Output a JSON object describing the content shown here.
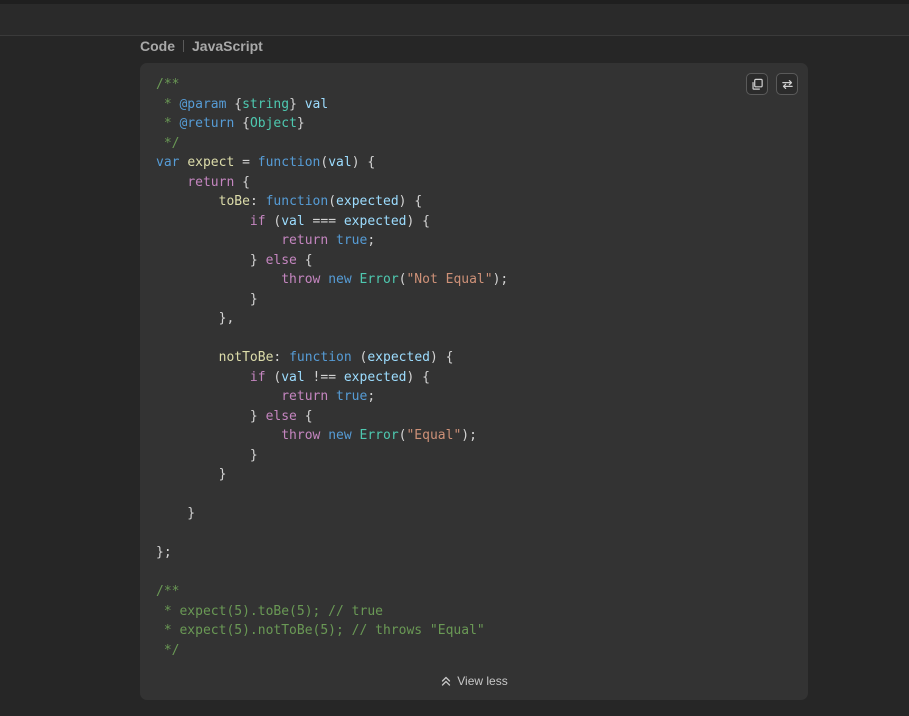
{
  "breadcrumb": {
    "section": "Code",
    "language": "JavaScript"
  },
  "toolbar": {
    "copy_icon": "copy-icon",
    "toggle_icon": "swap-arrows-icon"
  },
  "footer": {
    "toggle_label": "View less",
    "toggle_icon": "double-chevron-up-icon"
  },
  "code_lines": [
    [
      {
        "t": "/**",
        "c": "comment"
      }
    ],
    [
      {
        "t": " * ",
        "c": "comment"
      },
      {
        "t": "@param",
        "c": "tag"
      },
      {
        "t": " {",
        "c": "plain"
      },
      {
        "t": "string",
        "c": "type"
      },
      {
        "t": "} ",
        "c": "plain"
      },
      {
        "t": "val",
        "c": "var"
      }
    ],
    [
      {
        "t": " * ",
        "c": "comment"
      },
      {
        "t": "@return",
        "c": "tag"
      },
      {
        "t": " {",
        "c": "plain"
      },
      {
        "t": "Object",
        "c": "type"
      },
      {
        "t": "}",
        "c": "plain"
      }
    ],
    [
      {
        "t": " */",
        "c": "comment"
      }
    ],
    [
      {
        "t": "var",
        "c": "kw"
      },
      {
        "t": " ",
        "c": "plain"
      },
      {
        "t": "expect",
        "c": "fn"
      },
      {
        "t": " = ",
        "c": "plain"
      },
      {
        "t": "function",
        "c": "kw"
      },
      {
        "t": "(",
        "c": "plain"
      },
      {
        "t": "val",
        "c": "var"
      },
      {
        "t": ") {",
        "c": "plain"
      }
    ],
    [
      {
        "t": "    ",
        "c": "plain"
      },
      {
        "t": "return",
        "c": "ctrl"
      },
      {
        "t": " {",
        "c": "plain"
      }
    ],
    [
      {
        "t": "        ",
        "c": "plain"
      },
      {
        "t": "toBe",
        "c": "prop"
      },
      {
        "t": ": ",
        "c": "plain"
      },
      {
        "t": "function",
        "c": "kw"
      },
      {
        "t": "(",
        "c": "plain"
      },
      {
        "t": "expected",
        "c": "var"
      },
      {
        "t": ") {",
        "c": "plain"
      }
    ],
    [
      {
        "t": "            ",
        "c": "plain"
      },
      {
        "t": "if",
        "c": "ctrl"
      },
      {
        "t": " (",
        "c": "plain"
      },
      {
        "t": "val",
        "c": "var"
      },
      {
        "t": " === ",
        "c": "plain"
      },
      {
        "t": "expected",
        "c": "var"
      },
      {
        "t": ") {",
        "c": "plain"
      }
    ],
    [
      {
        "t": "                ",
        "c": "plain"
      },
      {
        "t": "return",
        "c": "ctrl"
      },
      {
        "t": " ",
        "c": "plain"
      },
      {
        "t": "true",
        "c": "bool"
      },
      {
        "t": ";",
        "c": "plain"
      }
    ],
    [
      {
        "t": "            } ",
        "c": "plain"
      },
      {
        "t": "else",
        "c": "ctrl"
      },
      {
        "t": " {",
        "c": "plain"
      }
    ],
    [
      {
        "t": "                ",
        "c": "plain"
      },
      {
        "t": "throw",
        "c": "ctrl"
      },
      {
        "t": " ",
        "c": "plain"
      },
      {
        "t": "new",
        "c": "kw"
      },
      {
        "t": " ",
        "c": "plain"
      },
      {
        "t": "Error",
        "c": "class"
      },
      {
        "t": "(",
        "c": "plain"
      },
      {
        "t": "\"Not Equal\"",
        "c": "str"
      },
      {
        "t": ");",
        "c": "plain"
      }
    ],
    [
      {
        "t": "            }",
        "c": "plain"
      }
    ],
    [
      {
        "t": "        },",
        "c": "plain"
      }
    ],
    [
      {
        "t": "",
        "c": "plain"
      }
    ],
    [
      {
        "t": "        ",
        "c": "plain"
      },
      {
        "t": "notToBe",
        "c": "prop"
      },
      {
        "t": ": ",
        "c": "plain"
      },
      {
        "t": "function",
        "c": "kw"
      },
      {
        "t": " (",
        "c": "plain"
      },
      {
        "t": "expected",
        "c": "var"
      },
      {
        "t": ") {",
        "c": "plain"
      }
    ],
    [
      {
        "t": "            ",
        "c": "plain"
      },
      {
        "t": "if",
        "c": "ctrl"
      },
      {
        "t": " (",
        "c": "plain"
      },
      {
        "t": "val",
        "c": "var"
      },
      {
        "t": " !== ",
        "c": "plain"
      },
      {
        "t": "expected",
        "c": "var"
      },
      {
        "t": ") {",
        "c": "plain"
      }
    ],
    [
      {
        "t": "                ",
        "c": "plain"
      },
      {
        "t": "return",
        "c": "ctrl"
      },
      {
        "t": " ",
        "c": "plain"
      },
      {
        "t": "true",
        "c": "bool"
      },
      {
        "t": ";",
        "c": "plain"
      }
    ],
    [
      {
        "t": "            } ",
        "c": "plain"
      },
      {
        "t": "else",
        "c": "ctrl"
      },
      {
        "t": " {",
        "c": "plain"
      }
    ],
    [
      {
        "t": "                ",
        "c": "plain"
      },
      {
        "t": "throw",
        "c": "ctrl"
      },
      {
        "t": " ",
        "c": "plain"
      },
      {
        "t": "new",
        "c": "kw"
      },
      {
        "t": " ",
        "c": "plain"
      },
      {
        "t": "Error",
        "c": "class"
      },
      {
        "t": "(",
        "c": "plain"
      },
      {
        "t": "\"Equal\"",
        "c": "str"
      },
      {
        "t": ");",
        "c": "plain"
      }
    ],
    [
      {
        "t": "            }",
        "c": "plain"
      }
    ],
    [
      {
        "t": "        }",
        "c": "plain"
      }
    ],
    [
      {
        "t": "",
        "c": "plain"
      }
    ],
    [
      {
        "t": "    }",
        "c": "plain"
      }
    ],
    [
      {
        "t": "",
        "c": "plain"
      }
    ],
    [
      {
        "t": "};",
        "c": "plain"
      }
    ],
    [
      {
        "t": "",
        "c": "plain"
      }
    ],
    [
      {
        "t": "/**",
        "c": "comment"
      }
    ],
    [
      {
        "t": " * expect(5).toBe(5); // true",
        "c": "comment"
      }
    ],
    [
      {
        "t": " * expect(5).notToBe(5); // throws \"Equal\"",
        "c": "comment"
      }
    ],
    [
      {
        "t": " */",
        "c": "comment"
      }
    ]
  ]
}
